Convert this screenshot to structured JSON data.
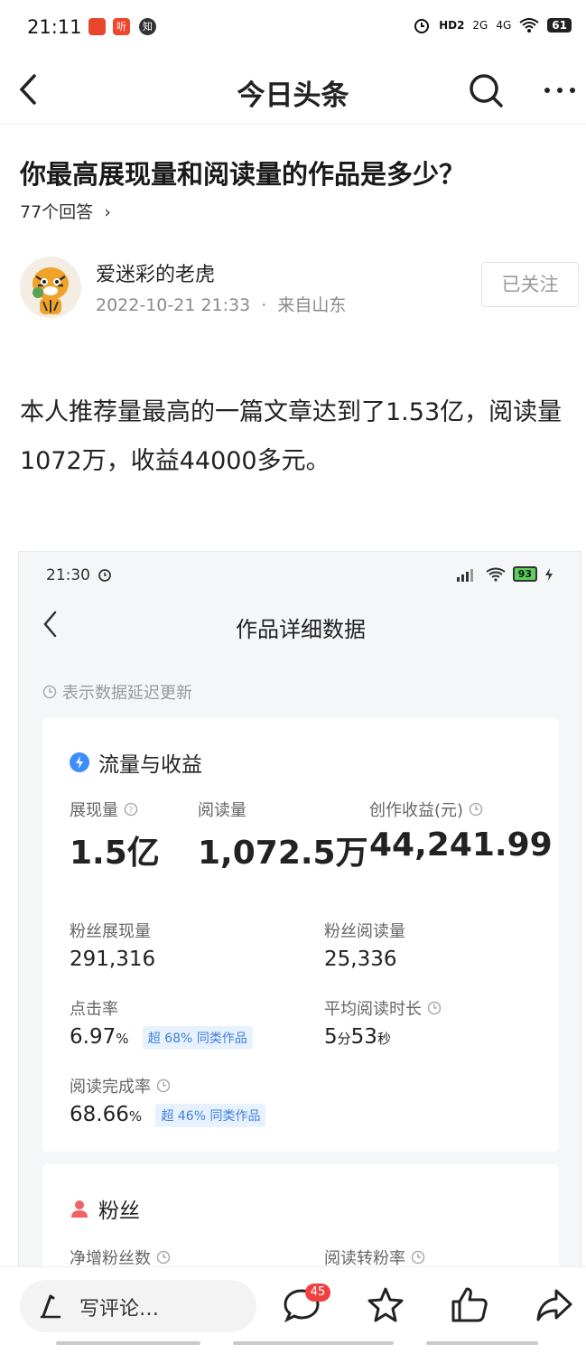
{
  "status_bar": {
    "time": "21:11",
    "app_icons": [
      "今日头条",
      "听",
      "知"
    ],
    "network": [
      "HD2",
      "2G",
      "4G"
    ],
    "battery": "61"
  },
  "nav": {
    "title": "今日头条",
    "icons": [
      "back-icon",
      "search-icon",
      "more-icon"
    ]
  },
  "question": {
    "title": "你最高展现量和阅读量的作品是多少？",
    "answers": "77个回答",
    "chevron": "›"
  },
  "author": {
    "name": "爱迷彩的老虎",
    "date": "2022-10-21 21:33",
    "location": "来自山东",
    "separator": "·",
    "follow_label": "已关注"
  },
  "content": {
    "text": "本人推荐量最高的一篇文章达到了1.53亿，阅读量1072万，收益44000多元。"
  },
  "embed": {
    "time": "21:30",
    "battery": "93",
    "title": "作品详细数据",
    "note": "表示数据延迟更新",
    "card1": {
      "title": "流量与收益",
      "impressions_label": "展现量",
      "impressions": "1.5亿",
      "reads_label": "阅读量",
      "reads": "1,072.5万",
      "income_label": "创作收益(元)",
      "income": "44,241.99",
      "fan_impressions_label": "粉丝展现量",
      "fan_impressions": "291,316",
      "fan_reads_label": "粉丝阅读量",
      "fan_reads": "25,336",
      "ctr_label": "点击率",
      "ctr_value": "6.97",
      "ctr_unit": "%",
      "ctr_badge": "超 68% 同类作品",
      "avg_time_label": "平均阅读时长",
      "avg_min": "5",
      "avg_min_unit": "分",
      "avg_sec": "53",
      "avg_sec_unit": "秒",
      "completion_label": "阅读完成率",
      "completion_value": "68.66",
      "completion_unit": "%",
      "completion_badge": "超 46% 同类作品"
    },
    "card2": {
      "title": "粉丝",
      "net_fans_label": "净增粉丝数",
      "conversion_label": "阅读转粉率"
    }
  },
  "bottom_bar": {
    "comment_placeholder": "写评论…",
    "comment_count": "45"
  },
  "colors": {
    "accent_blue": "#3d8dff",
    "badge_red": "#f04142",
    "fan_icon": "#f06363"
  }
}
